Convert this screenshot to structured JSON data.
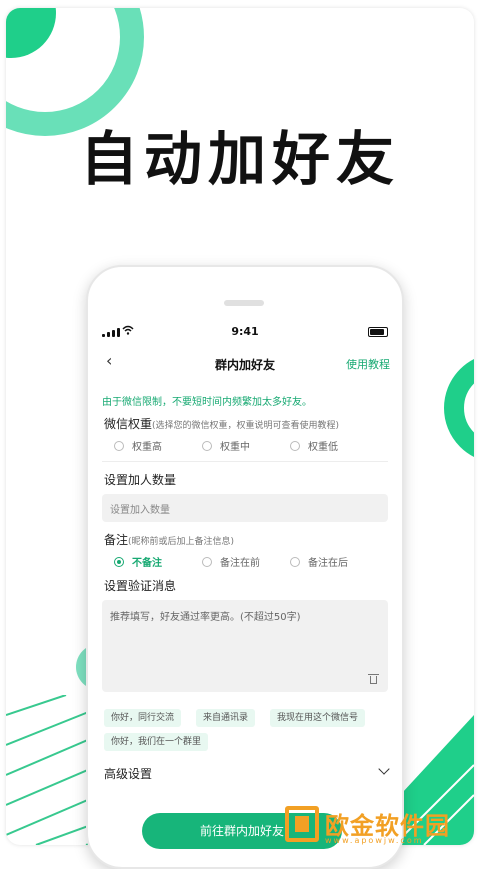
{
  "headline": "自动加好友",
  "status_bar": {
    "time": "9:41"
  },
  "nav": {
    "title": "群内加好友",
    "help_link": "使用教程"
  },
  "notice": "由于微信限制，不要短时间内频繁加太多好友。",
  "weight": {
    "label": "微信权重",
    "hint": "(选择您的微信权重，权重说明可查看使用教程)",
    "options": [
      "权重高",
      "权重中",
      "权重低"
    ]
  },
  "add_count": {
    "label": "设置加人数量",
    "placeholder": "设置加入数量"
  },
  "remark": {
    "label": "备注",
    "hint": "(昵称前或后加上备注信息)",
    "options": [
      "不备注",
      "备注在前",
      "备注在后"
    ],
    "selected": "不备注"
  },
  "verify": {
    "label": "设置验证消息",
    "placeholder": "推荐填写，好友通过率更高。(不超过50字)",
    "chips": [
      "你好，同行交流",
      "来自通讯录",
      "我现在用这个微信号",
      "你好，我们在一个群里"
    ]
  },
  "advanced": {
    "label": "高级设置"
  },
  "cta": {
    "label": "前往群内加好友"
  },
  "watermark": {
    "text": "欧金软件园",
    "sub": "www.apowjw.com"
  },
  "colors": {
    "accent": "#17a972",
    "button": "#17b57a",
    "watermark": "#f2a024"
  }
}
